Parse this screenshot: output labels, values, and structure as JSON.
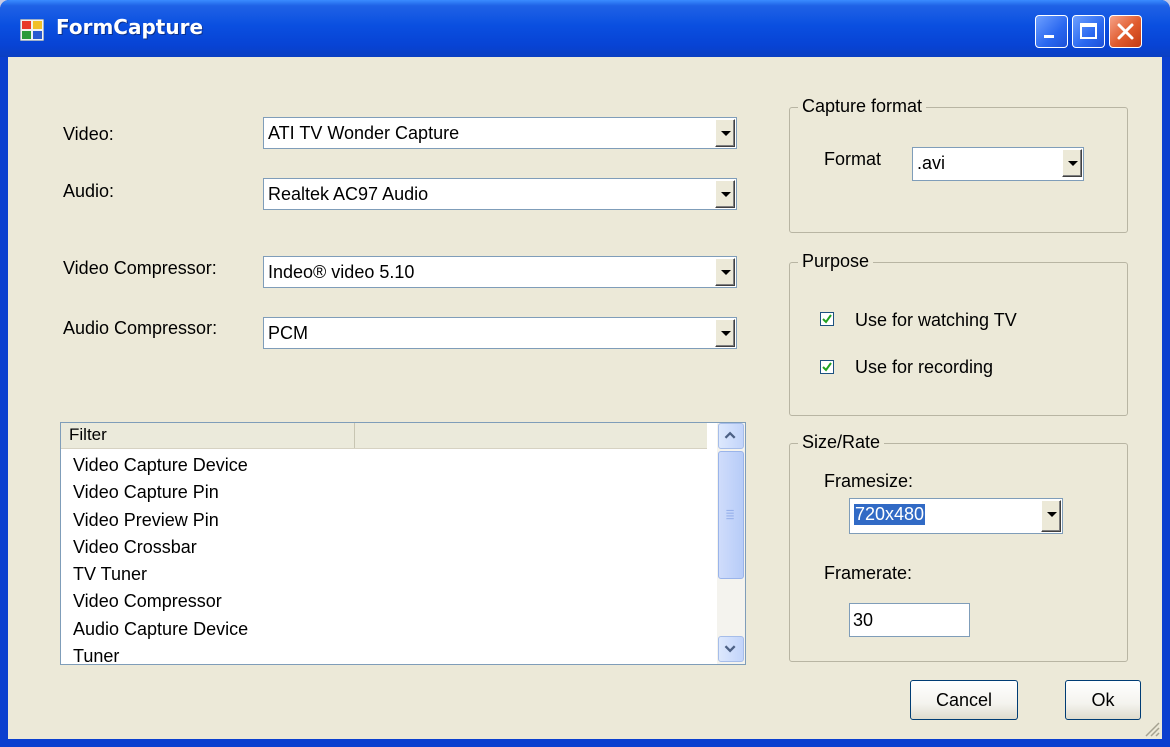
{
  "window": {
    "title": "FormCapture"
  },
  "titlebar": {
    "minimize_icon": "minimize-icon",
    "maximize_icon": "maximize-icon",
    "close_icon": "close-icon"
  },
  "devices": {
    "video_label": "Video:",
    "video_value": "ATI TV Wonder Capture",
    "audio_label": "Audio:",
    "audio_value": "Realtek AC97 Audio",
    "video_compressor_label": "Video Compressor:",
    "video_compressor_value": "Indeo® video 5.10",
    "audio_compressor_label": "Audio Compressor:",
    "audio_compressor_value": "PCM"
  },
  "capture_format": {
    "group_title": "Capture format",
    "format_label": "Format",
    "format_value": ".avi"
  },
  "purpose": {
    "group_title": "Purpose",
    "watching_tv_label": "Use for watching TV",
    "watching_tv_checked": true,
    "recording_label": "Use for recording",
    "recording_checked": true
  },
  "size_rate": {
    "group_title": "Size/Rate",
    "framesize_label": "Framesize:",
    "framesize_value": "720x480",
    "framerate_label": "Framerate:",
    "framerate_value": "30"
  },
  "filter_list": {
    "columns": [
      "Filter",
      ""
    ],
    "rows": [
      "Video Capture Device",
      "Video Capture Pin",
      "Video Preview Pin",
      "Video Crossbar",
      "TV Tuner",
      "Video Compressor",
      "Audio Capture Device",
      "Tuner"
    ]
  },
  "buttons": {
    "cancel": "Cancel",
    "ok": "Ok"
  },
  "colors": {
    "titlebar": "#0a4fe0",
    "client_bg": "#ece9d8",
    "selection": "#316ac5",
    "close_button": "#e05a2c"
  }
}
